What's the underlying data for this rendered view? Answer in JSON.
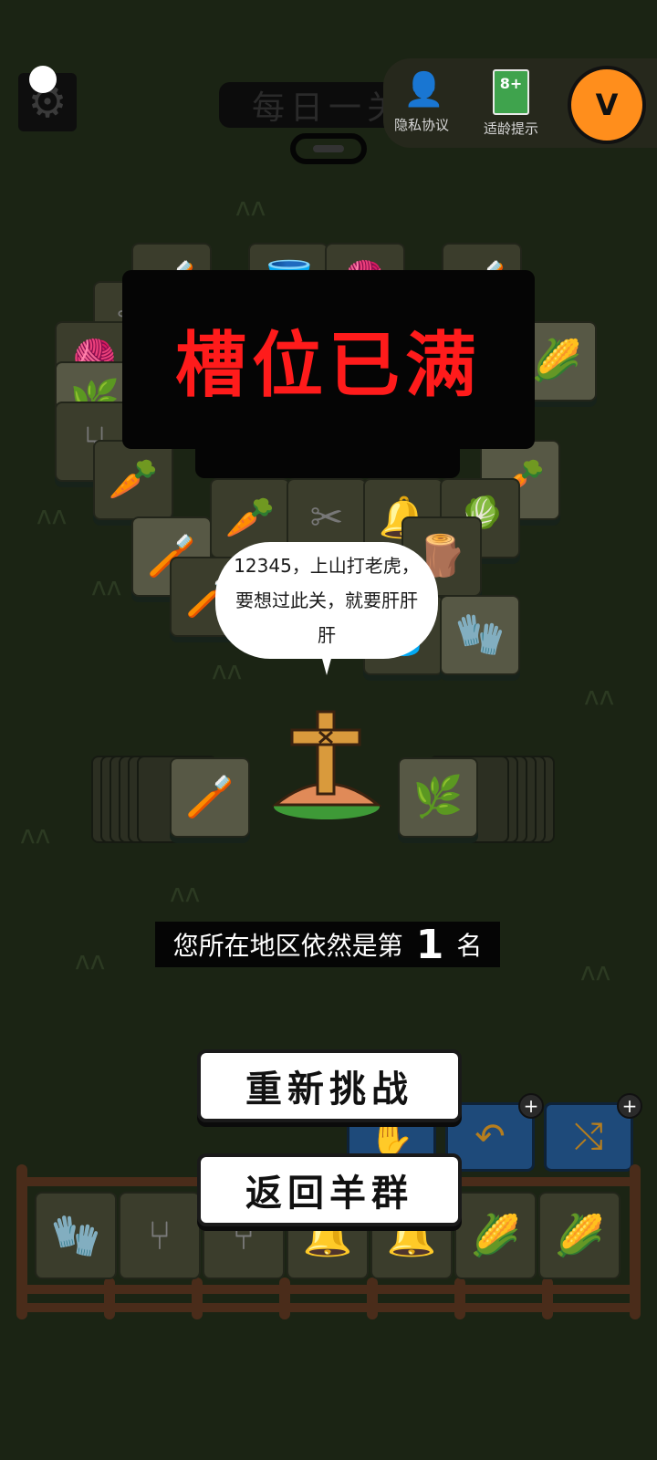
{
  "header": {
    "level_title": "每日一关",
    "menu": [
      {
        "label": "隐私协议",
        "icon": "user-icon"
      },
      {
        "label": "适龄提示",
        "icon": "age-rating-icon",
        "badge": "8+"
      }
    ]
  },
  "overlay": {
    "banner_text": "槽位已满",
    "speech_bubble": "12345，上山打老虎，要想过此关，就要肝肝肝",
    "rank_prefix": "您所在地区依然是第",
    "rank_value": "1",
    "rank_suffix": "名"
  },
  "buttons": {
    "retry": "重新挑战",
    "back": "返回羊群"
  },
  "colors": {
    "background": "#1b2414",
    "banner_text": "#ff1b1b",
    "logo": "#ff8e1c"
  }
}
